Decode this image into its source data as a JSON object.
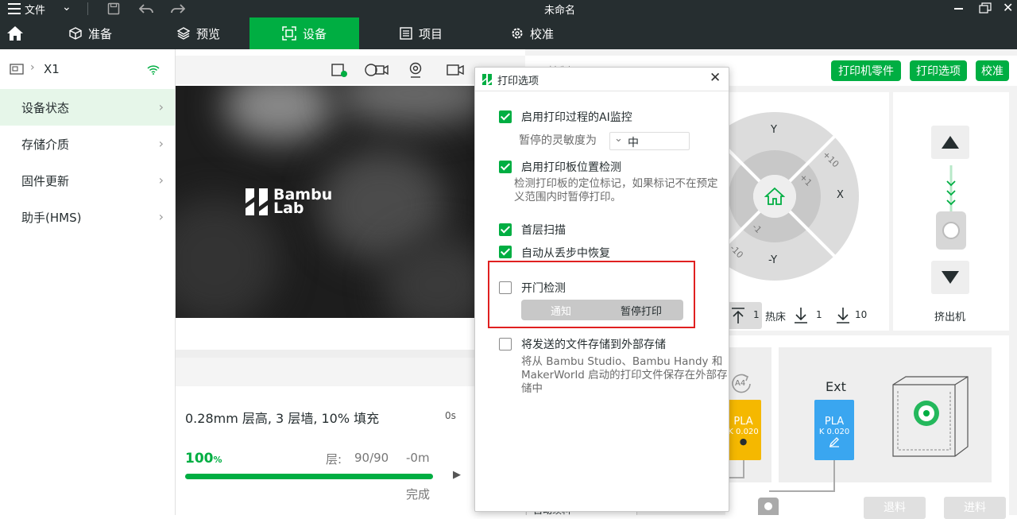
{
  "titlebar": {
    "menu_label": "文件",
    "title": "未命名"
  },
  "nav": {
    "tabs": [
      {
        "label": "准备"
      },
      {
        "label": "预览"
      },
      {
        "label": "设备"
      },
      {
        "label": "项目"
      },
      {
        "label": "校准"
      }
    ]
  },
  "sidebar": {
    "printer_name": "X1",
    "items": [
      {
        "label": "设备状态"
      },
      {
        "label": "存储介质"
      },
      {
        "label": "固件更新"
      },
      {
        "label": "助手(HMS)"
      }
    ]
  },
  "camera": {
    "logo_line1": "Bambu",
    "logo_line2": "Lab"
  },
  "progress": {
    "job_info": "0.28mm 层高, 3 层墙, 10% 填充",
    "time_hint": "0s",
    "percent": "100",
    "percent_unit": "%",
    "percent_value": 100,
    "layer_label": "层:",
    "layer_value": "90/90",
    "remaining": "-0m",
    "status": "完成"
  },
  "controls": {
    "header": "控制",
    "parts_button": "打印机零件",
    "options_button": "打印选项",
    "calibrate_button": "校准",
    "y_label": "Y",
    "x_label": "X",
    "neg_y_label": "-Y",
    "plus10": "+10",
    "plus1": "+1",
    "minus1": "-1",
    "minus10": "-10",
    "bed_label": "热床",
    "bed_up_value": "1",
    "bed_down1_value": "1",
    "bed_down10_value": "10",
    "extruder_label": "挤出机"
  },
  "filament": {
    "slot_tag": "A4",
    "ams_slot": {
      "type": "PLA",
      "k": "K 0.020",
      "color": "#f5b800"
    },
    "ext_label": "Ext",
    "ext_slot": {
      "type": "PLA",
      "k": "K 0.020",
      "color": "#3aa6f0"
    },
    "unload_button": "退料",
    "load_button": "进料",
    "auto_refill": "自动续料"
  },
  "dialog": {
    "title": "打印选项",
    "ai_monitor_label": "启用打印过程的AI监控",
    "ai_monitor_checked": true,
    "sensitivity_label": "暂停的灵敏度为",
    "sensitivity_value": "中",
    "plate_detect_label": "启用打印板位置检测",
    "plate_detect_checked": true,
    "plate_detect_desc": "检测打印板的定位标记，如果标记不在预定义范围内时暂停打印。",
    "first_layer_label": "首层扫描",
    "first_layer_checked": true,
    "recovery_label": "自动从丢步中恢复",
    "recovery_checked": true,
    "door_detect_label": "开门检测",
    "door_detect_checked": false,
    "door_option_notify": "通知",
    "door_option_pause": "暂停打印",
    "store_external_label": "将发送的文件存储到外部存储",
    "store_external_checked": false,
    "store_external_desc": "将从 Bambu Studio、Bambu Handy 和 MakerWorld 启动的打印文件保存在外部存储中"
  },
  "colors": {
    "accent": "#00ae42",
    "dark": "#262e30",
    "highlight_box": "#e02020"
  }
}
